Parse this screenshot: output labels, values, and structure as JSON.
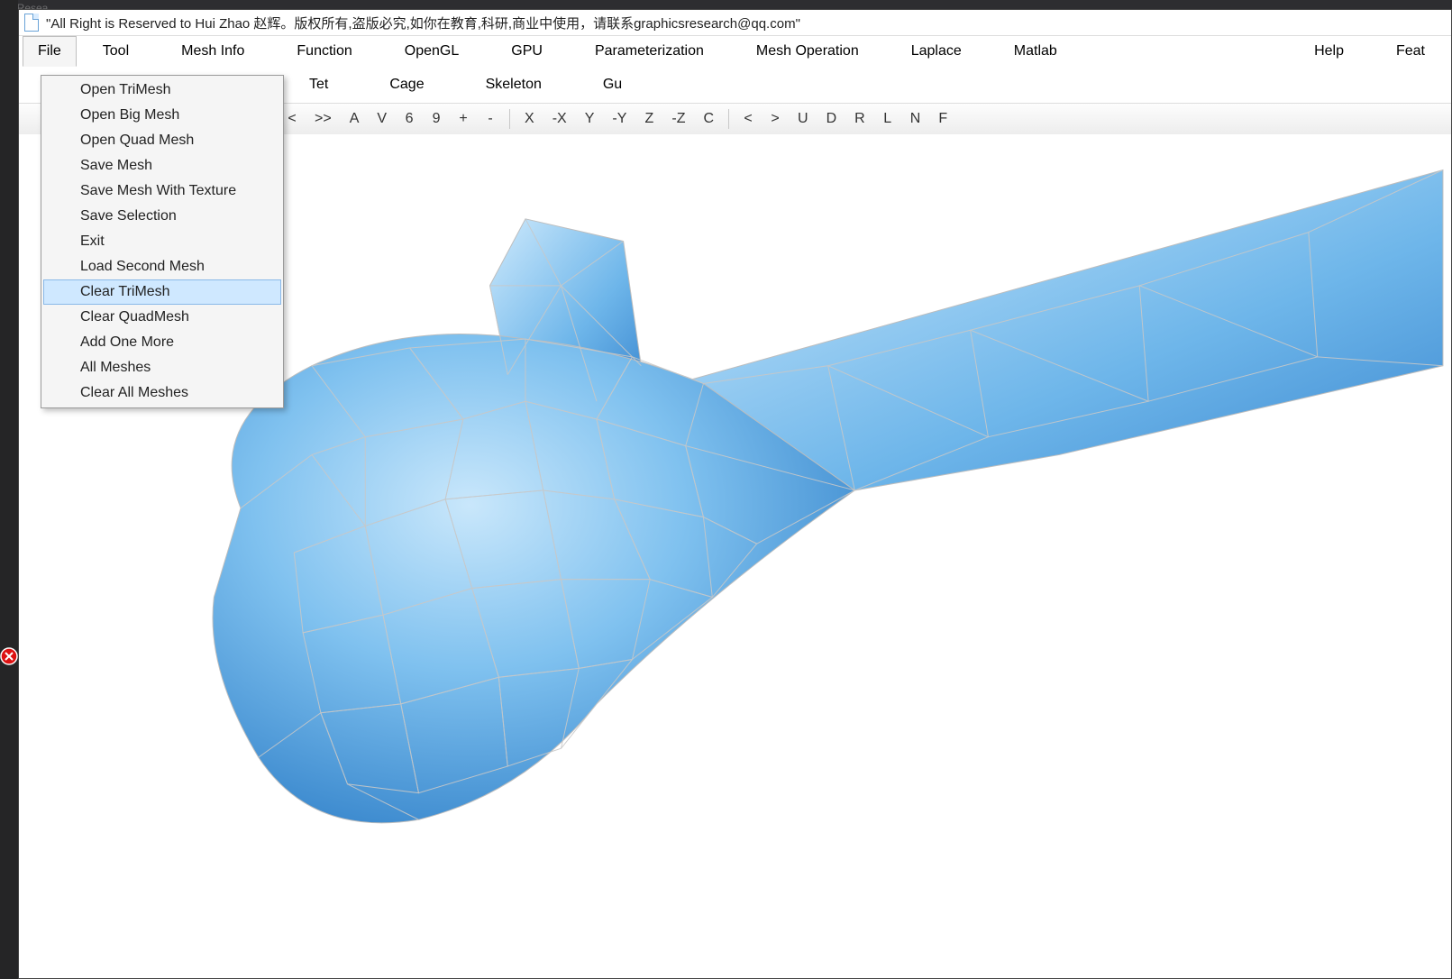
{
  "ide_hint": "icsResea",
  "window": {
    "title": "\"All Right is Reserved to Hui Zhao 赵辉。版权所有,盗版必究,如你在教育,科研,商业中使用，请联系graphicsresearch@qq.com\""
  },
  "menubar": {
    "items": [
      "File",
      "Tool",
      "Mesh Info",
      "Function",
      "OpenGL",
      "GPU",
      "Parameterization",
      "Mesh Operation",
      "Laplace",
      "Matlab",
      "Help",
      "Feat"
    ],
    "active_index": 0
  },
  "secondary_bar": {
    "items": [
      "Tet",
      "Cage",
      "Skeleton",
      "Gu"
    ]
  },
  "toolbar": {
    "items": [
      "<",
      ">>",
      "A",
      "V",
      "6",
      "9",
      "+",
      "-",
      "|",
      "X",
      "-X",
      "Y",
      "-Y",
      "Z",
      "-Z",
      "C",
      "|",
      "<",
      ">",
      "U",
      "D",
      "R",
      "L",
      "N",
      "F"
    ]
  },
  "file_menu": {
    "items": [
      "Open TriMesh",
      "Open Big Mesh",
      "Open Quad Mesh",
      "Save Mesh",
      "Save Mesh With Texture",
      "Save Selection",
      "Exit",
      "Load Second Mesh",
      "Clear TriMesh",
      "Clear QuadMesh",
      "Add One More",
      "All Meshes",
      "Clear All Meshes"
    ],
    "highlighted_index": 8
  },
  "colors": {
    "mesh_fill_light": "#9fd3f7",
    "mesh_fill_dark": "#3f8fd4",
    "mesh_edge": "#b8b8b8",
    "highlight_bg": "#cfe8ff",
    "highlight_border": "#8ab9e8"
  }
}
